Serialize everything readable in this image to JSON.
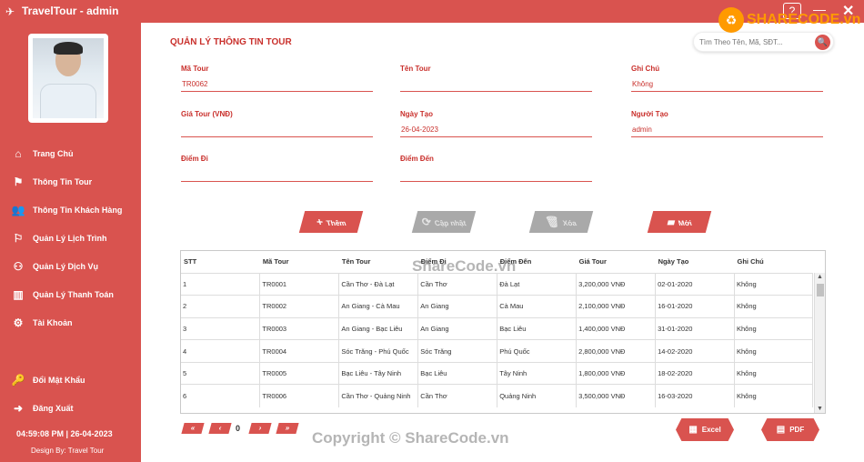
{
  "window": {
    "title": "TravelTour  - admin",
    "help_label": "?",
    "min_label": "—",
    "close_label": "✕"
  },
  "sidebar": {
    "menu": [
      {
        "icon": "⌂",
        "label": "Trang Chủ"
      },
      {
        "icon": "⚑",
        "label": "Thông Tin Tour"
      },
      {
        "icon": "👥",
        "label": "Thông Tin Khách Hàng"
      },
      {
        "icon": "⚐",
        "label": "Quản Lý Lịch Trình"
      },
      {
        "icon": "⚇",
        "label": "Quản Lý Dịch Vụ"
      },
      {
        "icon": "▥",
        "label": "Quản Lý Thanh Toán"
      },
      {
        "icon": "⚙",
        "label": "Tài Khoản"
      }
    ],
    "bottom_menu": [
      {
        "icon": "🔑",
        "label": "Đổi Mật Khẩu"
      },
      {
        "icon": "➜",
        "label": "Đăng Xuất"
      }
    ],
    "clock": "04:59:08 PM  | 26-04-2023",
    "design": "Design By: Travel Tour"
  },
  "main": {
    "title": "QUẢN LÝ THÔNG TIN TOUR",
    "search_placeholder": "Tìm Theo Tên, Mã, SĐT...",
    "search_icon": "🔍",
    "fields": {
      "ma_tour": {
        "label": "Mã Tour",
        "value": "TR0062"
      },
      "ten_tour": {
        "label": "Tên Tour",
        "value": ""
      },
      "ghi_chu": {
        "label": "Ghi Chú",
        "value": "Không"
      },
      "gia_tour": {
        "label": "Giá Tour (VNĐ)",
        "value": ""
      },
      "ngay_tao": {
        "label": "Ngày Tạo",
        "value": "26-04-2023"
      },
      "nguoi_tao": {
        "label": "Người Tạo",
        "value": "admin"
      },
      "diem_di": {
        "label": "Điểm Đi",
        "value": ""
      },
      "diem_den": {
        "label": "Điểm Đến",
        "value": ""
      }
    },
    "actions": {
      "add": {
        "icon": "+",
        "label": "Thêm"
      },
      "update": {
        "icon": "⟳",
        "label": "Cập nhật"
      },
      "delete": {
        "icon": "🗑",
        "label": "Xóa"
      },
      "new": {
        "icon": "▰",
        "label": "Mới"
      }
    },
    "table": {
      "headers": [
        "STT",
        "Mã Tour",
        "Tên Tour",
        "Điểm Đi",
        "Điểm Đến",
        "Giá Tour",
        "Ngày Tạo",
        "Ghi Chú"
      ],
      "rows": [
        [
          "1",
          "TR0001",
          "Cần Thơ - Đà Lạt",
          "Cần Thơ",
          "Đà Lạt",
          "3,200,000 VNĐ",
          "02-01-2020",
          "Không"
        ],
        [
          "2",
          "TR0002",
          "An Giang - Cà Mau",
          "An Giang",
          "Cà Mau",
          "2,100,000 VNĐ",
          "16-01-2020",
          "Không"
        ],
        [
          "3",
          "TR0003",
          "An Giang - Bạc Liêu",
          "An Giang",
          "Bạc Liêu",
          "1,400,000 VNĐ",
          "31-01-2020",
          "Không"
        ],
        [
          "4",
          "TR0004",
          "Sóc Trăng - Phú Quốc",
          "Sóc Trăng",
          "Phú Quốc",
          "2,800,000 VNĐ",
          "14-02-2020",
          "Không"
        ],
        [
          "5",
          "TR0005",
          "Bạc Liêu - Tây Ninh",
          "Bạc Liêu",
          "Tây Ninh",
          "1,800,000 VNĐ",
          "18-02-2020",
          "Không"
        ],
        [
          "6",
          "TR0006",
          "Cần Thơ - Quảng Ninh",
          "Cần Thơ",
          "Quảng Ninh",
          "3,500,000 VNĐ",
          "16-03-2020",
          "Không"
        ]
      ]
    },
    "pager": {
      "first": "«",
      "prev": "‹",
      "page": "0",
      "next": "›",
      "last": "»"
    },
    "export": {
      "excel": {
        "icon": "▦",
        "label": "Excel"
      },
      "pdf": {
        "icon": "▤",
        "label": "PDF"
      }
    }
  },
  "watermarks": {
    "center": "ShareCode.vn",
    "bottom": "Copyright © ShareCode.vn",
    "brand": "SHARECODE.vn",
    "brand_icon": "♻"
  }
}
